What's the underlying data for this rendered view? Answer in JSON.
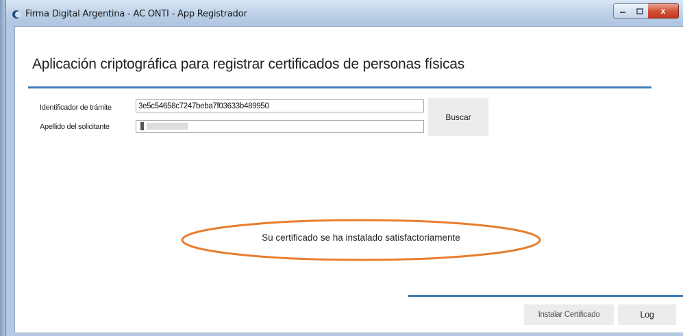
{
  "window": {
    "title": "Firma Digital Argentina - AC ONTI - App Registrador",
    "icon": "app-crescent-icon",
    "controls": {
      "minimize": "minimize-icon",
      "maximize": "maximize-icon",
      "close": "close-icon",
      "close_glyph": "x"
    }
  },
  "main": {
    "heading": "Aplicación criptográfica para registrar certificados de personas físicas",
    "form": {
      "tramite_label": "Identificador de trámite",
      "tramite_value": "3e5c54658c7247beba7f03633b489950",
      "apellido_label": "Apellido del solicitante",
      "apellido_value": ""
    },
    "search_button": "Buscar",
    "status_message": "Su certificado se ha instalado satisfactoriamente",
    "highlight_color": "#e87d2e"
  },
  "footer": {
    "install_button": "Instalar Certificado",
    "log_button": "Log"
  },
  "colors": {
    "accent_rule": "#3f7cb6",
    "button_bg": "#ececec"
  }
}
